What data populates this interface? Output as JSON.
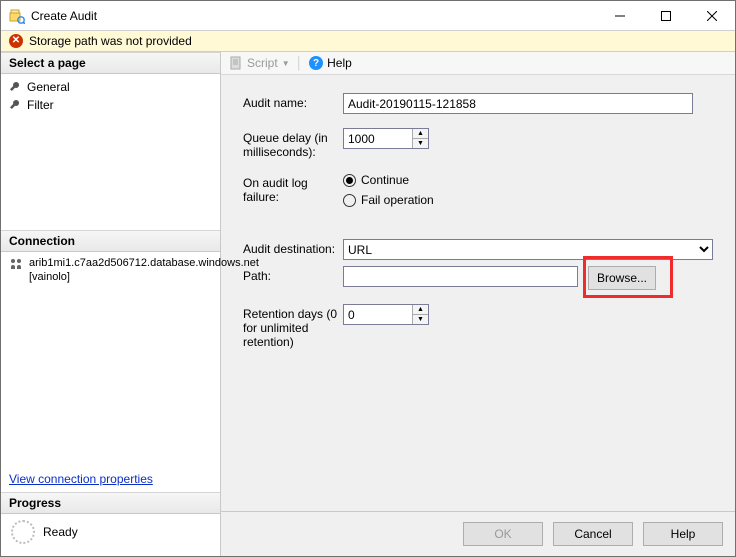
{
  "window": {
    "title": "Create Audit"
  },
  "error": {
    "message": "Storage path was not provided"
  },
  "pages": {
    "header": "Select a page",
    "items": [
      {
        "label": "General"
      },
      {
        "label": "Filter"
      }
    ]
  },
  "connection": {
    "header": "Connection",
    "server": "arib1mi1.c7aa2d506712.database.windows.net [vainolo]",
    "link": "View connection properties"
  },
  "progress": {
    "header": "Progress",
    "status": "Ready"
  },
  "toolbar": {
    "script": "Script",
    "help": "Help"
  },
  "form": {
    "audit_name_label": "Audit name:",
    "audit_name_value": "Audit-20190115-121858",
    "queue_delay_label": "Queue delay (in milliseconds):",
    "queue_delay_value": "1000",
    "on_failure_label": "On audit log failure:",
    "on_failure_continue": "Continue",
    "on_failure_fail": "Fail operation",
    "destination_label": "Audit destination:",
    "destination_value": "URL",
    "path_label": "Path:",
    "path_value": "",
    "browse_label": "Browse...",
    "retention_label": "Retention days (0 for unlimited retention)",
    "retention_value": "0"
  },
  "buttons": {
    "ok": "OK",
    "cancel": "Cancel",
    "help": "Help"
  }
}
